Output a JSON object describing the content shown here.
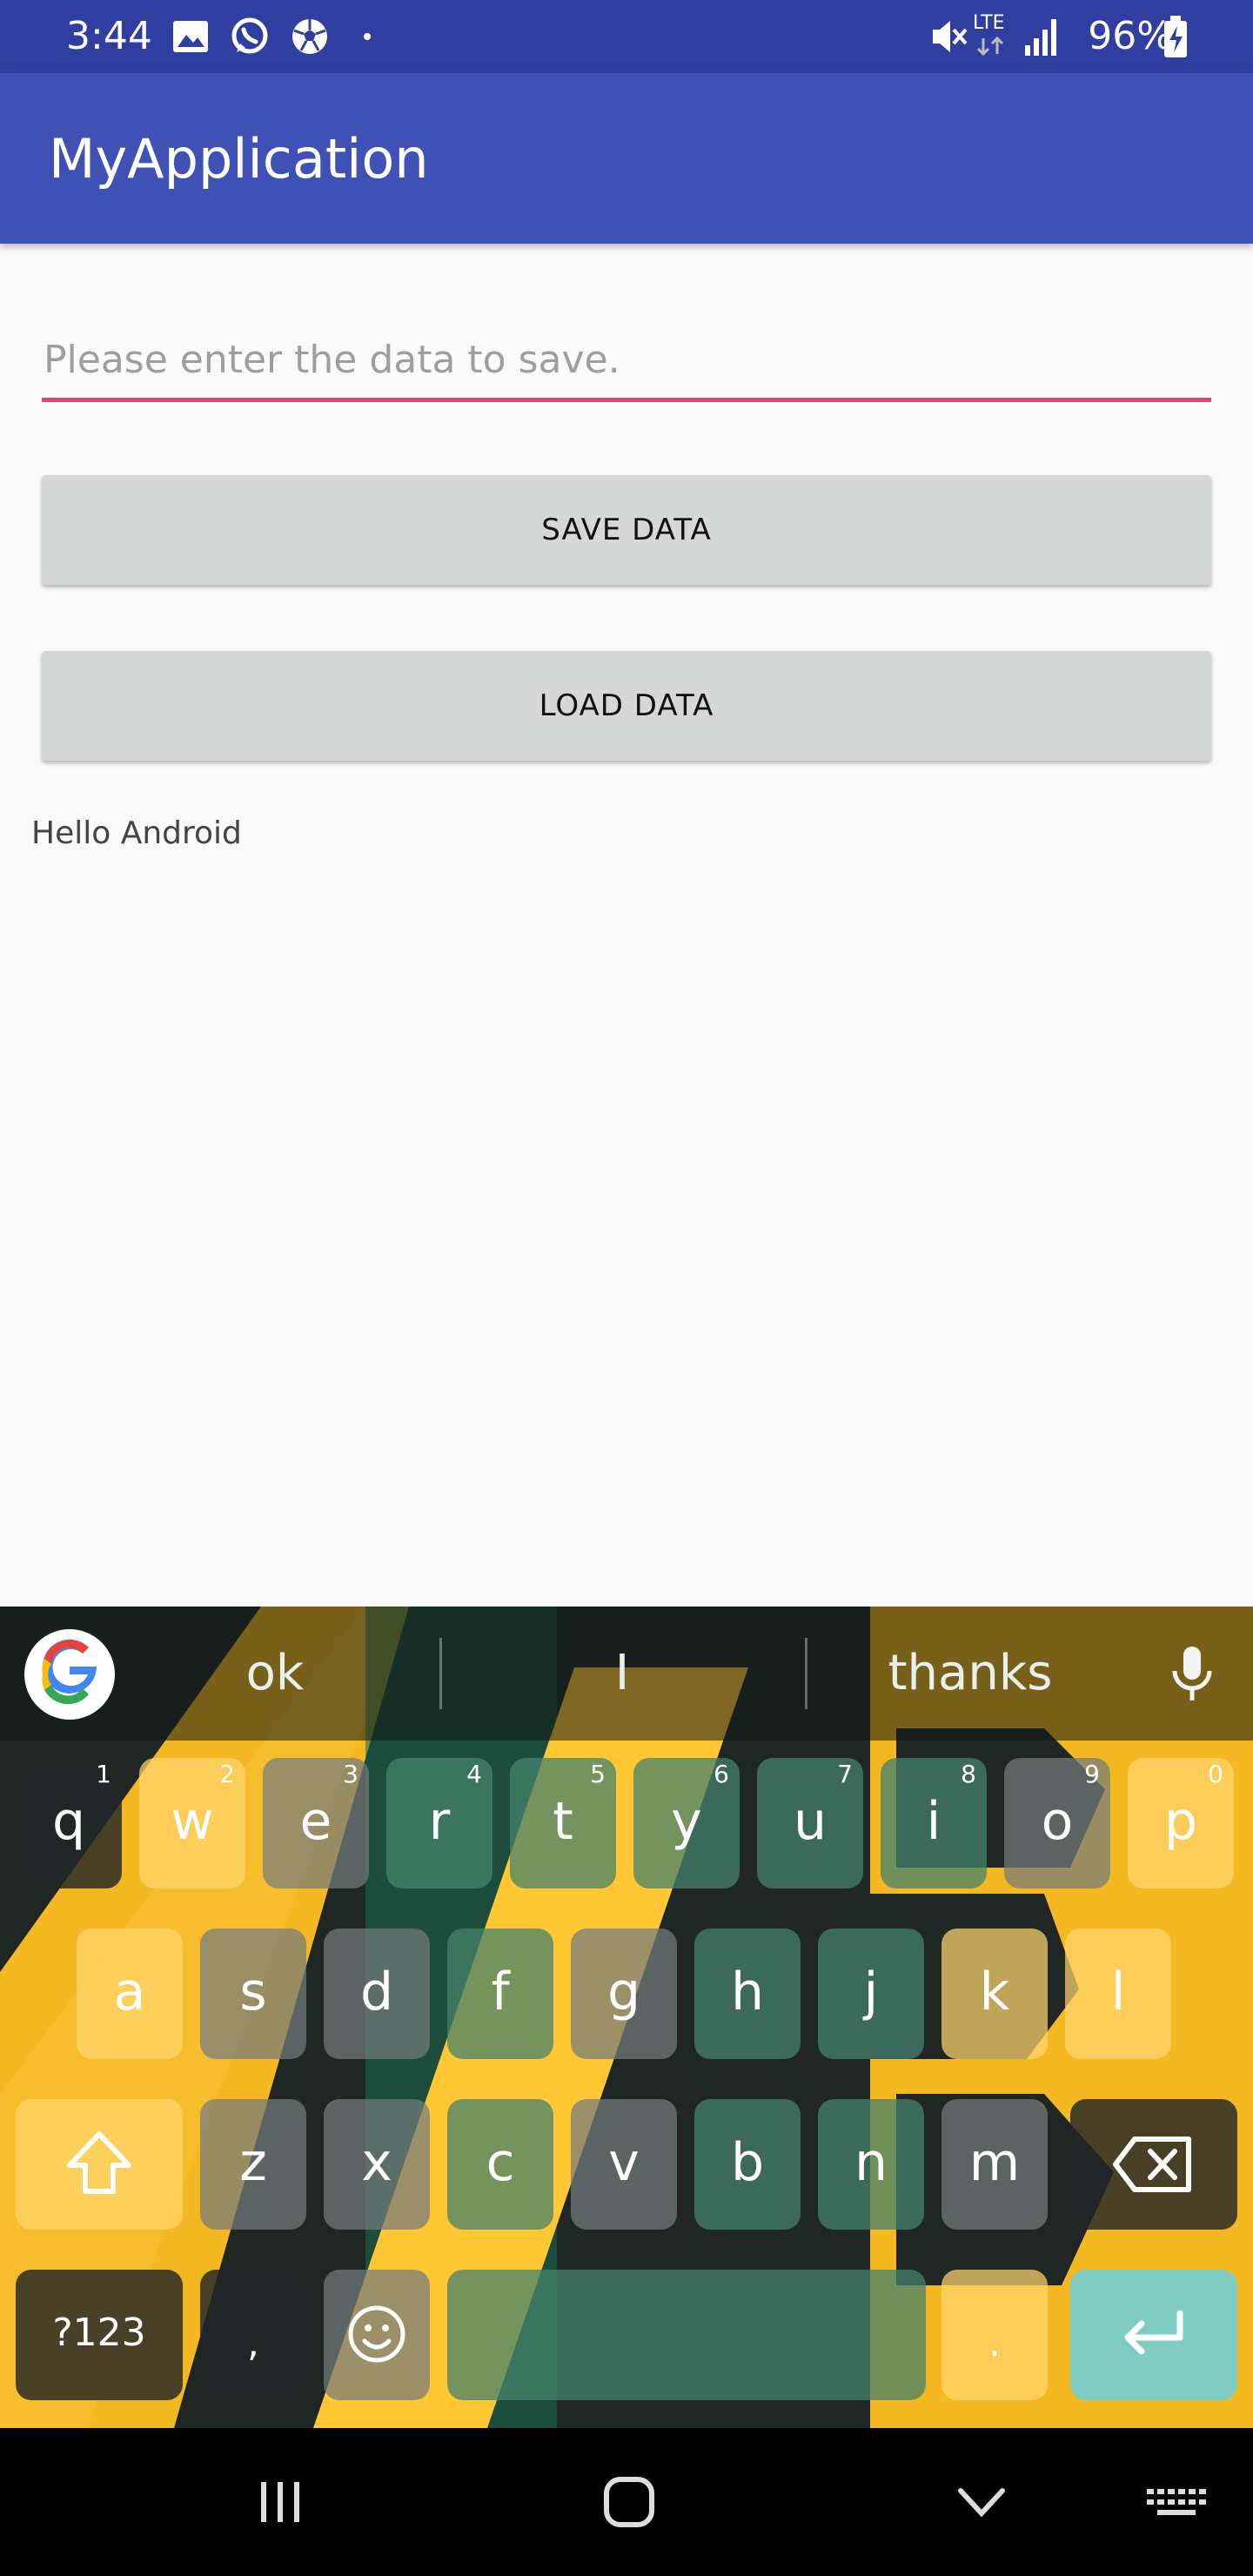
{
  "status_bar": {
    "time": "3:44",
    "network": "LTE",
    "battery": "96%",
    "icons": [
      "image-icon",
      "whatsapp-icon",
      "soccer-ball-icon",
      "dot-icon",
      "vibrate-mute-icon",
      "lte-icon",
      "signal-icon",
      "battery-charging-icon"
    ]
  },
  "app_bar": {
    "title": "MyApplication",
    "color": "#3f51b5",
    "status_color": "#303f9f"
  },
  "main": {
    "input_placeholder": "Please enter the data to save.",
    "input_value": "",
    "save_button": "SAVE DATA",
    "load_button": "LOAD DATA",
    "hello_text": "Hello Android",
    "accent": "#e0437a"
  },
  "keyboard": {
    "suggestions": [
      "ok",
      "I",
      "thanks"
    ],
    "row1": [
      {
        "k": "q",
        "h": "1"
      },
      {
        "k": "w",
        "h": "2"
      },
      {
        "k": "e",
        "h": "3"
      },
      {
        "k": "r",
        "h": "4"
      },
      {
        "k": "t",
        "h": "5"
      },
      {
        "k": "y",
        "h": "6"
      },
      {
        "k": "u",
        "h": "7"
      },
      {
        "k": "i",
        "h": "8"
      },
      {
        "k": "o",
        "h": "9"
      },
      {
        "k": "p",
        "h": "0"
      }
    ],
    "row2": [
      "a",
      "s",
      "d",
      "f",
      "g",
      "h",
      "j",
      "k",
      "l"
    ],
    "row3": [
      "z",
      "x",
      "c",
      "v",
      "b",
      "n",
      "m"
    ],
    "symbols_label": "?123",
    "comma": ",",
    "period": "."
  }
}
